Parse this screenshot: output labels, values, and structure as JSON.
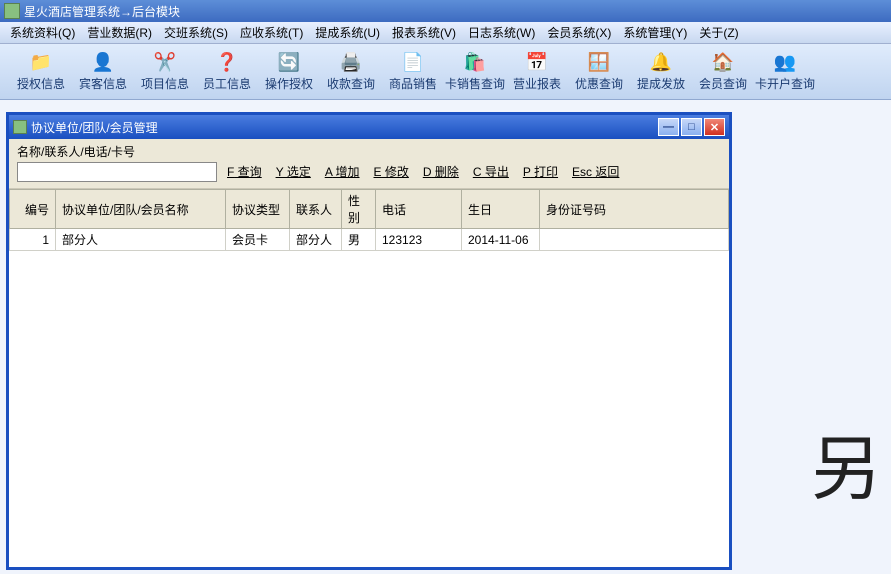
{
  "mainTitle": "星火酒店管理系统→后台模块",
  "menus": [
    "系统资料(Q)",
    "营业数据(R)",
    "交班系统(S)",
    "应收系统(T)",
    "提成系统(U)",
    "报表系统(V)",
    "日志系统(W)",
    "会员系统(X)",
    "系统管理(Y)",
    "关于(Z)"
  ],
  "toolbar": [
    {
      "name": "auth-info",
      "icon": "📁",
      "label": "授权信息"
    },
    {
      "name": "guest-info",
      "icon": "👤",
      "label": "宾客信息"
    },
    {
      "name": "project-info",
      "icon": "✂️",
      "label": "项目信息"
    },
    {
      "name": "staff-info",
      "icon": "❓",
      "label": "员工信息"
    },
    {
      "name": "op-auth",
      "icon": "🔄",
      "label": "操作授权"
    },
    {
      "name": "collect-query",
      "icon": "🖨️",
      "label": "收款查询"
    },
    {
      "name": "goods-sale",
      "icon": "📄",
      "label": "商品销售"
    },
    {
      "name": "card-sale",
      "icon": "🛍️",
      "label": "卡销售查询"
    },
    {
      "name": "biz-report",
      "icon": "📅",
      "label": "营业报表"
    },
    {
      "name": "discount-q",
      "icon": "🪟",
      "label": "优惠查询"
    },
    {
      "name": "bonus-grant",
      "icon": "🔔",
      "label": "提成发放"
    },
    {
      "name": "member-q",
      "icon": "🏠",
      "label": "会员查询"
    },
    {
      "name": "card-open",
      "icon": "👥",
      "label": "卡开户查询"
    }
  ],
  "childTitle": "协议单位/团队/会员管理",
  "searchLabel": "名称/联系人/电话/卡号",
  "searchValue": "",
  "actions": [
    {
      "key": "F",
      "text": "查询"
    },
    {
      "key": "Y",
      "text": "选定"
    },
    {
      "key": "A",
      "text": "增加"
    },
    {
      "key": "E",
      "text": "修改"
    },
    {
      "key": "D",
      "text": "删除"
    },
    {
      "key": "C",
      "text": "导出"
    },
    {
      "key": "P",
      "text": "打印"
    },
    {
      "key": "Esc",
      "text": "返回"
    }
  ],
  "columns": [
    "编号",
    "协议单位/团队/会员名称",
    "协议类型",
    "联系人",
    "性别",
    "电话",
    "生日",
    "身份证号码"
  ],
  "rows": [
    {
      "id": "1",
      "name": "部分人",
      "type": "会员卡",
      "contact": "部分人",
      "gender": "男",
      "phone": "123123",
      "bday": "2014-11-06",
      "idno": ""
    }
  ],
  "bgDeco": "另"
}
